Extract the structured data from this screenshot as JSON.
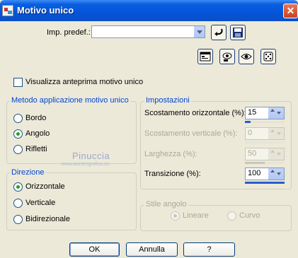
{
  "window": {
    "title": "Motivo unico",
    "close_glyph": "✕"
  },
  "presets": {
    "label": "Imp. predef.:",
    "value": ""
  },
  "preview_checkbox": {
    "label": "Visualizza anteprima motivo unico",
    "checked": false
  },
  "method_group": {
    "title": "Metodo applicazione motivo unico",
    "options": [
      {
        "label": "Bordo",
        "selected": false
      },
      {
        "label": "Angolo",
        "selected": true
      },
      {
        "label": "Rifletti",
        "selected": false
      }
    ]
  },
  "direction_group": {
    "title": "Direzione",
    "options": [
      {
        "label": "Orizzontale",
        "selected": true
      },
      {
        "label": "Verticale",
        "selected": false
      },
      {
        "label": "Bidirezionale",
        "selected": false
      }
    ]
  },
  "settings_group": {
    "title": "Impostazioni",
    "horizontal_offset": {
      "label": "Scostamento orizzontale (%):",
      "value": "15",
      "enabled": true,
      "fill": 0.15
    },
    "vertical_offset": {
      "label": "Scostamento verticale (%):",
      "value": "0",
      "enabled": false,
      "fill": 0.0
    },
    "width": {
      "label": "Larghezza (%):",
      "value": "50",
      "enabled": false,
      "fill": 0.5
    },
    "transition": {
      "label": "Transizione (%):",
      "value": "100",
      "enabled": true,
      "fill": 1.0
    }
  },
  "corner_style_group": {
    "title": "Stile angolo",
    "options": [
      {
        "label": "Lineare",
        "selected": true,
        "enabled": false
      },
      {
        "label": "Curvo",
        "selected": false,
        "enabled": false
      }
    ]
  },
  "watermark": {
    "text": "Pinuccia",
    "subtext": "www.wordregrafica.eu"
  },
  "buttons": {
    "ok": "OK",
    "cancel": "Annulla",
    "help": "?"
  },
  "colors": {
    "title_bar": "#0a5fe0",
    "dialog_bg": "#ece9d8",
    "slider_fill": "#2b5bd0",
    "radio_dot": "#21a121"
  }
}
